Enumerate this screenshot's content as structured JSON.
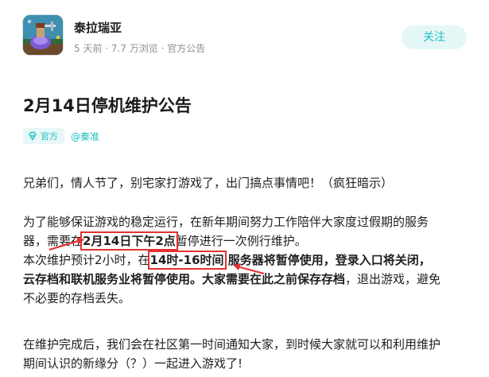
{
  "header": {
    "game_name": "泰拉瑞亚",
    "meta": "5 天前 · 7.7 万浏览 · 官方公告",
    "follow_label": "关注"
  },
  "post": {
    "title": "2月14日停机维护公告",
    "official_tag": "官方",
    "author": "@秦准"
  },
  "content": {
    "p1": "兄弟们，情人节了，别宅家打游戏了，出门搞点事情吧！（疯狂暗示）",
    "p2_line1": "为了能够保证游戏的稳定运行，在新年期间努力工作陪伴大家度过假期的服务",
    "p2_line2_pre": "器，需要在",
    "p2_highlight_date": "2月14日下午2点",
    "p2_line2_post": "暂停进行一次例行维护。",
    "p3_line1_pre": "本次维护预计2小时，在",
    "p3_highlight_time": "14时-16时间",
    "p3_line1_post": " 服务器将暂停使用，登录入口将关闭，",
    "p3_line2_bold": "云存档和联机服务业将暂停使用。大家需要在此之前保存存档",
    "p3_line2_post": "，退出游戏，避免",
    "p3_line3": "不必要的存档丢失。",
    "p4_line1": "在维护完成后，我们会在社区第一时间通知大家，到时候大家就可以和利用维护",
    "p4_line2": "期间认识的新缘分（？）一起进入游戏了!"
  },
  "colors": {
    "accent": "#1dbfc1",
    "follow_bg": "#e5f6f7",
    "annotation_red": "#e23131",
    "meta_gray": "#8d9297"
  },
  "icons": {
    "official": "diamond-badge-icon",
    "app": "terraria-app-icon"
  }
}
